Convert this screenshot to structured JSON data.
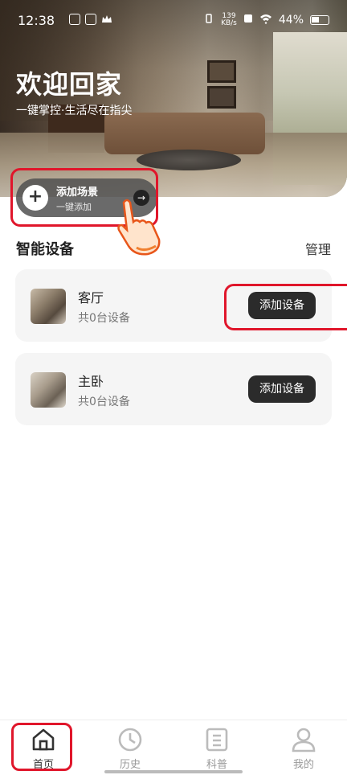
{
  "status_bar": {
    "time": "12:38",
    "net_speed_value": "139",
    "net_speed_unit": "KB/s",
    "battery": "44%"
  },
  "hero": {
    "title": "欢迎回家",
    "subtitle": "一键掌控·生活尽在指尖"
  },
  "add_scene": {
    "plus": "+",
    "title": "添加场景",
    "subtitle": "一键添加",
    "arrow": "→"
  },
  "devices": {
    "title": "智能设备",
    "manage": "管理",
    "rooms": [
      {
        "name": "客厅",
        "count": "共0台设备",
        "button": "添加设备"
      },
      {
        "name": "主卧",
        "count": "共0台设备",
        "button": "添加设备"
      }
    ]
  },
  "nav": {
    "items": [
      {
        "label": "首页",
        "icon": "home-icon",
        "active": true
      },
      {
        "label": "历史",
        "icon": "clock-icon",
        "active": false
      },
      {
        "label": "科普",
        "icon": "document-icon",
        "active": false
      },
      {
        "label": "我的",
        "icon": "user-icon",
        "active": false
      }
    ]
  },
  "colors": {
    "highlight_box": "#e0162b",
    "button_dark": "#2b2b2b",
    "card_bg": "#f5f5f5"
  }
}
